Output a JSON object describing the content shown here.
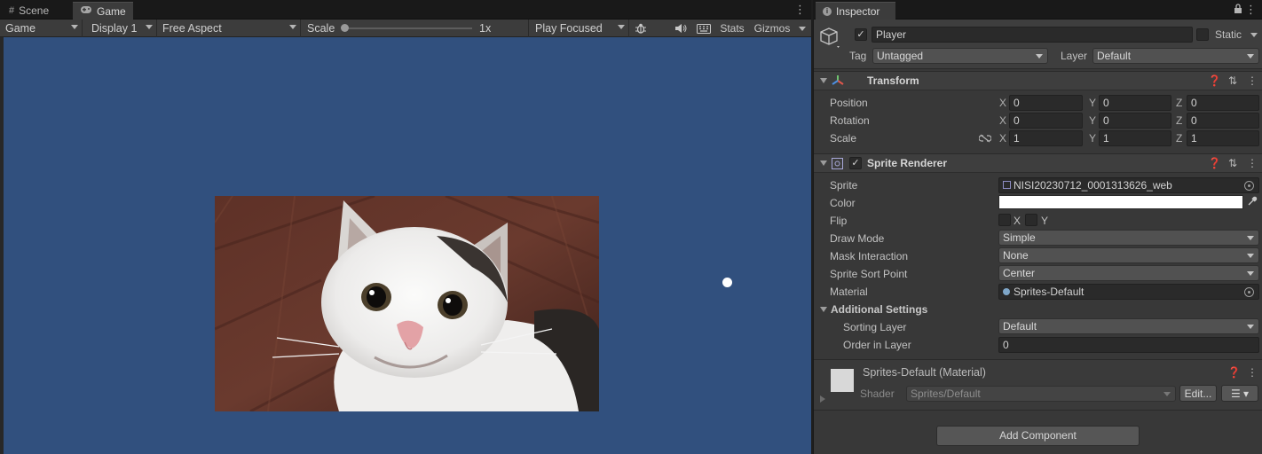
{
  "tabs": {
    "scene": "Scene",
    "game": "Game",
    "inspector": "Inspector"
  },
  "game_toolbar": {
    "mode": "Game",
    "display": "Display 1",
    "aspect": "Free Aspect",
    "scale_label": "Scale",
    "scale_value": "1x",
    "play_mode": "Play Focused",
    "stats": "Stats",
    "gizmos": "Gizmos"
  },
  "game_view": {
    "background_color": "#31507e",
    "sprite": "cat-photo",
    "dot_color": "#ffffff"
  },
  "object": {
    "name": "Player",
    "active": true,
    "static_label": "Static",
    "static": false,
    "tag_label": "Tag",
    "tag": "Untagged",
    "layer_label": "Layer",
    "layer": "Default"
  },
  "transform": {
    "title": "Transform",
    "position": {
      "label": "Position",
      "x": "0",
      "y": "0",
      "z": "0"
    },
    "rotation": {
      "label": "Rotation",
      "x": "0",
      "y": "0",
      "z": "0"
    },
    "scale": {
      "label": "Scale",
      "x": "1",
      "y": "1",
      "z": "1"
    },
    "axis_x": "X",
    "axis_y": "Y",
    "axis_z": "Z"
  },
  "sprite_renderer": {
    "title": "Sprite Renderer",
    "enabled": true,
    "sprite_label": "Sprite",
    "sprite": "NISI20230712_0001313626_web",
    "color_label": "Color",
    "color": "#ffffff",
    "flip_label": "Flip",
    "flip_x": "X",
    "flip_y": "Y",
    "draw_mode_label": "Draw Mode",
    "draw_mode": "Simple",
    "mask_label": "Mask Interaction",
    "mask": "None",
    "sort_point_label": "Sprite Sort Point",
    "sort_point": "Center",
    "material_label": "Material",
    "material": "Sprites-Default",
    "additional_label": "Additional Settings",
    "sorting_layer_label": "Sorting Layer",
    "sorting_layer": "Default",
    "order_label": "Order in Layer",
    "order": "0"
  },
  "material_section": {
    "title": "Sprites-Default (Material)",
    "shader_label": "Shader",
    "shader": "Sprites/Default",
    "edit_button": "Edit..."
  },
  "add_component": "Add Component"
}
